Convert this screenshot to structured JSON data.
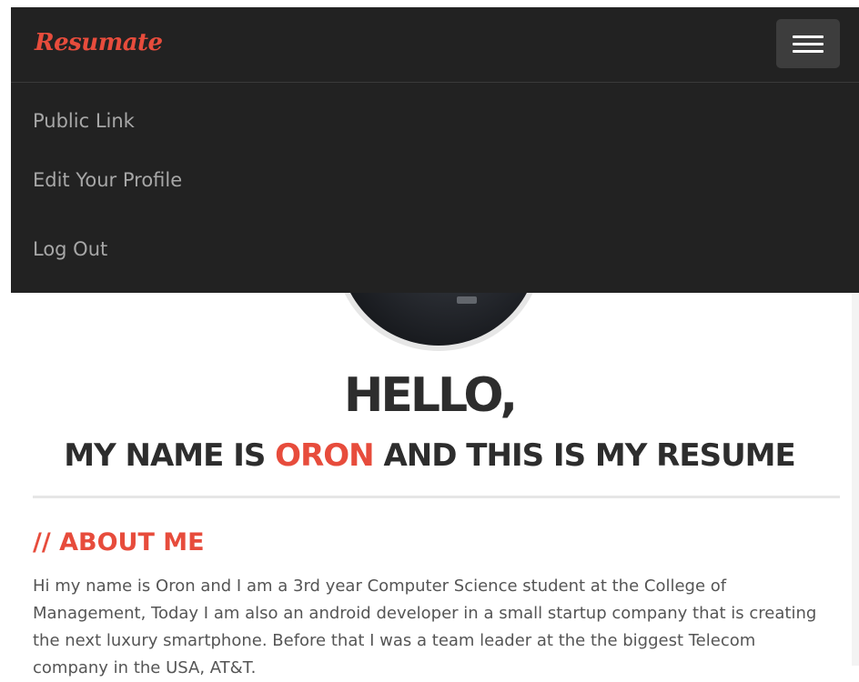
{
  "navbar": {
    "brand": "Resumate",
    "menu": {
      "public_link": "Public Link",
      "edit_profile": "Edit Your Profile",
      "log_out": "Log Out"
    }
  },
  "hero": {
    "hello": "HELLO,",
    "subtitle_prefix": "MY NAME IS ",
    "name": "ORON",
    "subtitle_suffix": " AND THIS IS MY RESUME"
  },
  "about": {
    "title": "// ABOUT ME",
    "text": "Hi my name is Oron and I am a 3rd year Computer Science student at the College of Management, Today I am also an android developer in a small startup company that is creating the next luxury smartphone. Before that I was a team leader at the the biggest Telecom company in the USA, AT&T."
  },
  "colors": {
    "accent": "#e74c3c",
    "navbar_bg": "#222222",
    "menu_link": "#a7a7a7",
    "heading": "#2d2d2d",
    "body_text": "#555555"
  },
  "icons": {
    "menu_toggle": "hamburger-icon"
  }
}
